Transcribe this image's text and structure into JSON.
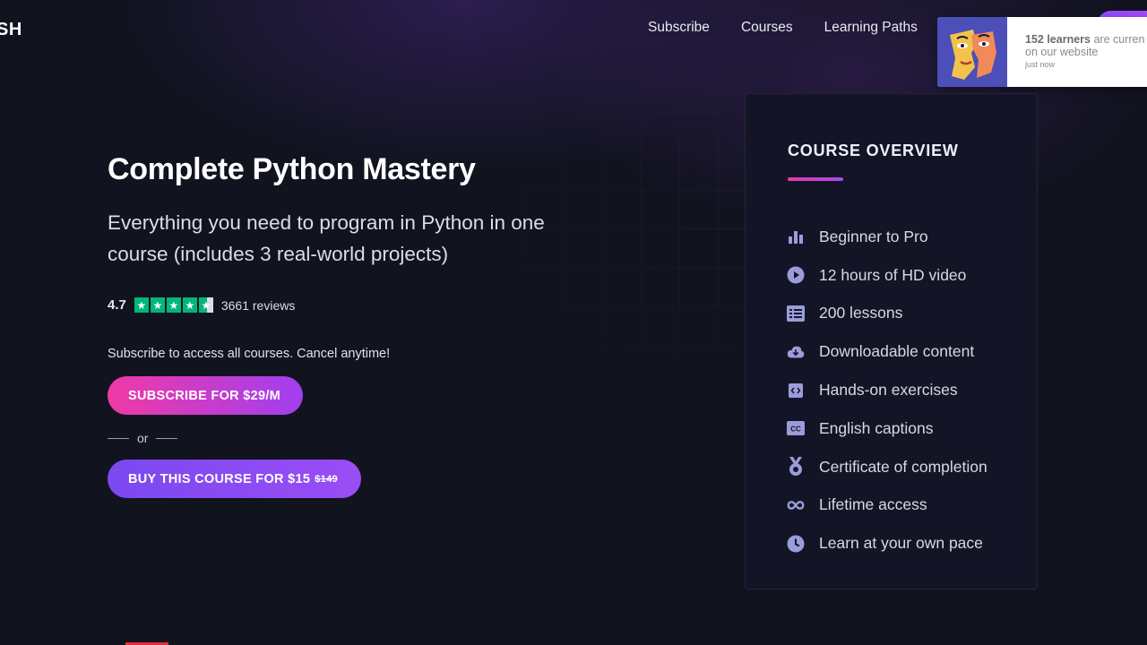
{
  "header": {
    "logo": "SH",
    "nav": [
      "Subscribe",
      "Courses",
      "Learning Paths"
    ]
  },
  "notification": {
    "count_text": "152 learners",
    "rest_line1": " are curren",
    "line2": "on our website",
    "time": "just now"
  },
  "hero": {
    "title": "Complete Python Mastery",
    "subtitle": "Everything you need to program in Python in one course (includes 3 real-world projects)",
    "rating_value": "4.7",
    "stars": 4.5,
    "reviews": "3661 reviews",
    "subscribe_note": "Subscribe to access all courses. Cancel anytime!",
    "subscribe_button": "SUBSCRIBE FOR $29/M",
    "or": "or",
    "buy_button": "BUY THIS COURSE FOR $15",
    "buy_old_price": "$149"
  },
  "overview": {
    "title": "COURSE OVERVIEW",
    "items": [
      {
        "icon": "bar-chart-icon",
        "label": "Beginner to Pro"
      },
      {
        "icon": "play-icon",
        "label": "12 hours of HD video"
      },
      {
        "icon": "list-icon",
        "label": "200 lessons"
      },
      {
        "icon": "cloud-download-icon",
        "label": "Downloadable content"
      },
      {
        "icon": "code-icon",
        "label": "Hands-on exercises"
      },
      {
        "icon": "captions-icon",
        "label": "English captions"
      },
      {
        "icon": "medal-icon",
        "label": "Certificate of completion"
      },
      {
        "icon": "infinity-icon",
        "label": "Lifetime access"
      },
      {
        "icon": "clock-icon",
        "label": "Learn at your own pace"
      }
    ]
  },
  "colors": {
    "background": "#11131f",
    "icon": "#9a9cdc",
    "star": "#00b67a",
    "subscribe_gradient": [
      "#f03aa6",
      "#a03ff0"
    ],
    "buy_gradient": [
      "#7b49f0",
      "#9a4df5"
    ]
  }
}
